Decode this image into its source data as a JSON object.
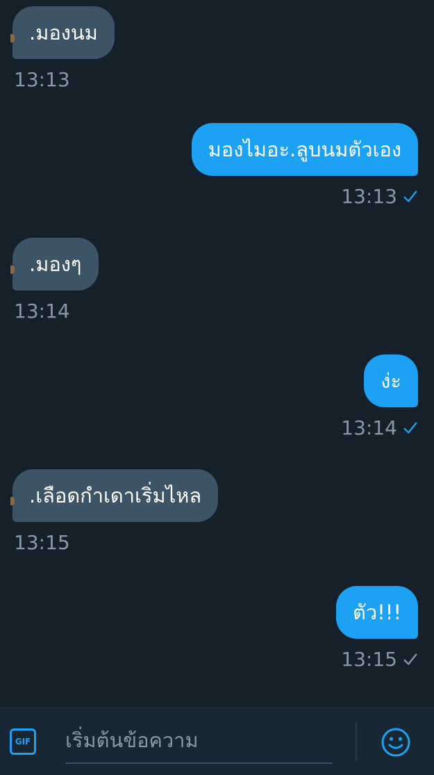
{
  "messages": [
    {
      "direction": "in",
      "text": ".มองนม",
      "time": "13:13"
    },
    {
      "direction": "out",
      "text": "มองไมอะ.ลูบนมตัวเอง",
      "time": "13:13",
      "status": "sent"
    },
    {
      "direction": "in",
      "text": ".มองๆ",
      "time": "13:14"
    },
    {
      "direction": "out",
      "text": "ง่ะ",
      "time": "13:14",
      "status": "sent"
    },
    {
      "direction": "in",
      "text": ".เลือดกำเดาเริ่มไหล",
      "time": "13:15"
    },
    {
      "direction": "out",
      "text": "ตัว!!!",
      "time": "13:15",
      "status": "sent"
    }
  ],
  "composer": {
    "gif_label": "GIF",
    "placeholder": "เริ่มต้นข้อความ",
    "emoji_icon": "smiley-icon"
  },
  "colors": {
    "background": "#15202b",
    "incoming_bubble": "#3d5466",
    "outgoing_bubble": "#1da1f2",
    "meta_text": "#8899a6",
    "read_check": "#1da1f2",
    "unread_check": "#8899a6"
  }
}
